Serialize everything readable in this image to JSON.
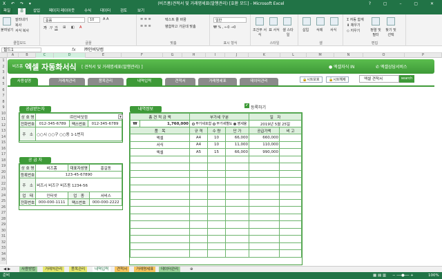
{
  "window": {
    "title": "(비즈폼)견적서 및 거래명세표(발행관리) [호환 모드] - Microsoft Excel",
    "controls": "? ▢ – ▢ ✕"
  },
  "ribbon": {
    "tabs": [
      "파일",
      "홈",
      "삽입",
      "페이지 레이아웃",
      "수식",
      "데이터",
      "검토",
      "보기"
    ],
    "active_tab": "홈",
    "clipboard": {
      "paste": "붙여넣기",
      "cut": "잘라내기",
      "copy": "복사",
      "format_painter": "서식 복사",
      "label": "클립보드"
    },
    "font": {
      "name": "돋움",
      "size": "10",
      "label": "글꼴"
    },
    "alignment": {
      "wrap": "텍스트 줄 바꿈",
      "merge": "병합하고 가운데 맞춤",
      "label": "맞춤"
    },
    "number": {
      "format": "일반",
      "label": "표시 형식"
    },
    "styles": {
      "conditional": "조건부 서식",
      "table": "표 서식",
      "cell": "셀 스타일",
      "label": "스타일"
    },
    "cells": {
      "insert": "삽입",
      "delete": "삭제",
      "format": "서식",
      "label": "셀"
    },
    "editing": {
      "autosum": "자동 합계",
      "fill": "채우기",
      "clear": "지우기",
      "sort": "정렬 및 필터",
      "find": "찾기 및 선택",
      "label": "편집"
    }
  },
  "formula_bar": {
    "name_box": "필드1",
    "fx": "fx",
    "value": "㈜인비닷컴"
  },
  "columns": [
    "A",
    "B",
    "C",
    "D",
    "E",
    "F",
    "G",
    "H",
    "I",
    "J",
    "K",
    "L",
    "M",
    "N",
    "O",
    "P"
  ],
  "rows": [
    "1",
    "2",
    "3",
    "4",
    "5",
    "6",
    "7",
    "8",
    "9",
    "10",
    "11",
    "12",
    "13",
    "14",
    "15",
    "16",
    "17",
    "18",
    "19",
    "20",
    "21",
    "22",
    "23",
    "24",
    "25",
    "26",
    "27",
    "28",
    "29",
    "30",
    "31",
    "32",
    "33",
    "34",
    "35"
  ],
  "banner": {
    "brand": "비즈폼",
    "title": "엑셀 자동화서식",
    "subtitle": "[ 견적서 및 거래명세표(발행관리) ]",
    "link1": "엑셀자식 IN",
    "link2": "엑셀상담서비스"
  },
  "nav": {
    "tabs": [
      "사용설명",
      "거래처관리",
      "품목관리",
      "내역입력",
      "견적서",
      "거래명세표",
      "데이터관리"
    ],
    "active": "내역입력",
    "sheet_protect": "시트보호",
    "sheet_unprotect": "시트해제",
    "search_value": "엑셀 견적서",
    "search_button": "search"
  },
  "supplied_to": {
    "header": "공급받는자",
    "company_label": "상 호 명",
    "company_value": "㈜인비닷컴",
    "phone_label": "전화번호",
    "phone_value": "012-345-6789",
    "fax_label": "팩스번호",
    "fax_value": "012-345-6789",
    "address_label": "주　소",
    "address_value": "○○시 ○○구 ○○동 1-1번지"
  },
  "supplier": {
    "header": "공 급 자",
    "company_label": "상 호 명",
    "company_value": "비즈폼",
    "rep_label": "대표자성명",
    "rep_value": "홍길동",
    "regno_label": "등록번호",
    "regno_value": "123-45-67890",
    "address_label": "주　소",
    "address_value": "비즈시 비즈구 비즈동 1234-56",
    "biz_label": "업　태",
    "biz_value": "인터넷",
    "type_label": "업　종",
    "type_value": "서비스",
    "phone_label": "전화번호",
    "phone_value": "000-000-1111",
    "fax_label": "팩스번호",
    "fax_value": "000-000-2222"
  },
  "details": {
    "header": "내역정보",
    "register": "등록하기",
    "total_label": "총 견 적 금 액",
    "vat_label": "부가세 구분",
    "date_label": "일　자",
    "currency": "₩",
    "total_value": "1,760,000",
    "vat_options": [
      "부가세포함",
      "부가세별도",
      "영세율"
    ],
    "vat_selected": 2,
    "date_value": "2019년 5월 25일",
    "columns": [
      "품　목",
      "규 격",
      "수 량",
      "단 가",
      "공급가액",
      "비 고"
    ],
    "items": [
      [
        "액셀",
        "A4",
        "10",
        "66,000",
        "660,000",
        ""
      ],
      [
        "서식",
        "A4",
        "10",
        "11,000",
        "110,000",
        ""
      ],
      [
        "엑셀",
        "A5",
        "15",
        "66,000",
        "990,000",
        ""
      ]
    ]
  },
  "sheet_tabs": [
    "사용방법",
    "거래처관리",
    "품목관리",
    "내역입력",
    "견적서",
    "거래명세표",
    "데이터관리"
  ],
  "active_sheet": "내역입력",
  "status": {
    "ready": "준비",
    "zoom": "100%"
  }
}
